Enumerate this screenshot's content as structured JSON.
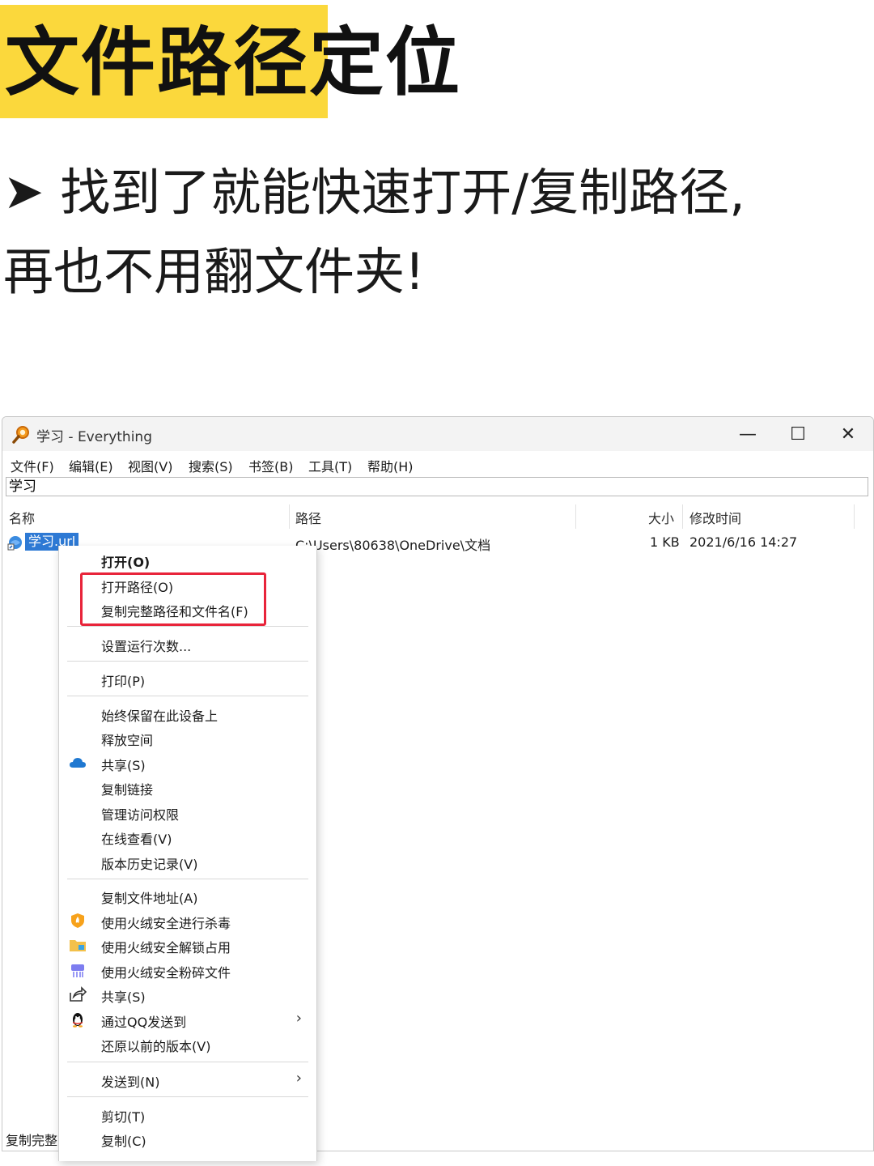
{
  "headline": {
    "title": "文件路径定位",
    "subtitle_line1": "找到了就能快速打开/复制路径,",
    "subtitle_line2": "再也不用翻文件夹!",
    "bullet": "➤",
    "highlight_color": "#fbd83c"
  },
  "window": {
    "title": "学习 - Everything",
    "controls": {
      "minimize": "—",
      "maximize": "☐",
      "close": "✕"
    },
    "menu": [
      "文件(F)",
      "编辑(E)",
      "视图(V)",
      "搜索(S)",
      "书签(B)",
      "工具(T)",
      "帮助(H)"
    ],
    "search_value": "学习",
    "columns": {
      "name": "名称",
      "path": "路径",
      "size": "大小",
      "modified": "修改时间"
    },
    "row": {
      "name": "学习.url",
      "path": "C:\\Users\\80638\\OneDrive\\文档",
      "size": "1 KB",
      "modified": "2021/6/16 14:27"
    },
    "status": "复制完整",
    "selection_color": "#2d79d4"
  },
  "context_menu": {
    "items": [
      {
        "label": "打开(O)",
        "icon": ""
      },
      {
        "label": "打开路径(O)",
        "icon": ""
      },
      {
        "label": "复制完整路径和文件名(F)",
        "icon": ""
      },
      {
        "label": "设置运行次数...",
        "icon": ""
      },
      {
        "label": "打印(P)",
        "icon": ""
      },
      {
        "label": "始终保留在此设备上",
        "icon": ""
      },
      {
        "label": "释放空间",
        "icon": ""
      },
      {
        "label": "共享(S)",
        "icon": "onedrive-cloud-icon"
      },
      {
        "label": "复制链接",
        "icon": ""
      },
      {
        "label": "管理访问权限",
        "icon": ""
      },
      {
        "label": "在线查看(V)",
        "icon": ""
      },
      {
        "label": "版本历史记录(V)",
        "icon": ""
      },
      {
        "label": "复制文件地址(A)",
        "icon": ""
      },
      {
        "label": "使用火绒安全进行杀毒",
        "icon": "huorong-shield-icon"
      },
      {
        "label": "使用火绒安全解锁占用",
        "icon": "folder-unlock-icon"
      },
      {
        "label": "使用火绒安全粉碎文件",
        "icon": "shredder-icon"
      },
      {
        "label": "共享(S)",
        "icon": "share-icon"
      },
      {
        "label": "通过QQ发送到",
        "icon": "qq-penguin-icon",
        "submenu": "›"
      },
      {
        "label": "还原以前的版本(V)",
        "icon": ""
      },
      {
        "label": "发送到(N)",
        "icon": "",
        "submenu": "›"
      },
      {
        "label": "剪切(T)",
        "icon": ""
      },
      {
        "label": "复制(C)",
        "icon": ""
      }
    ],
    "highlight_border_color": "#e8243a"
  }
}
